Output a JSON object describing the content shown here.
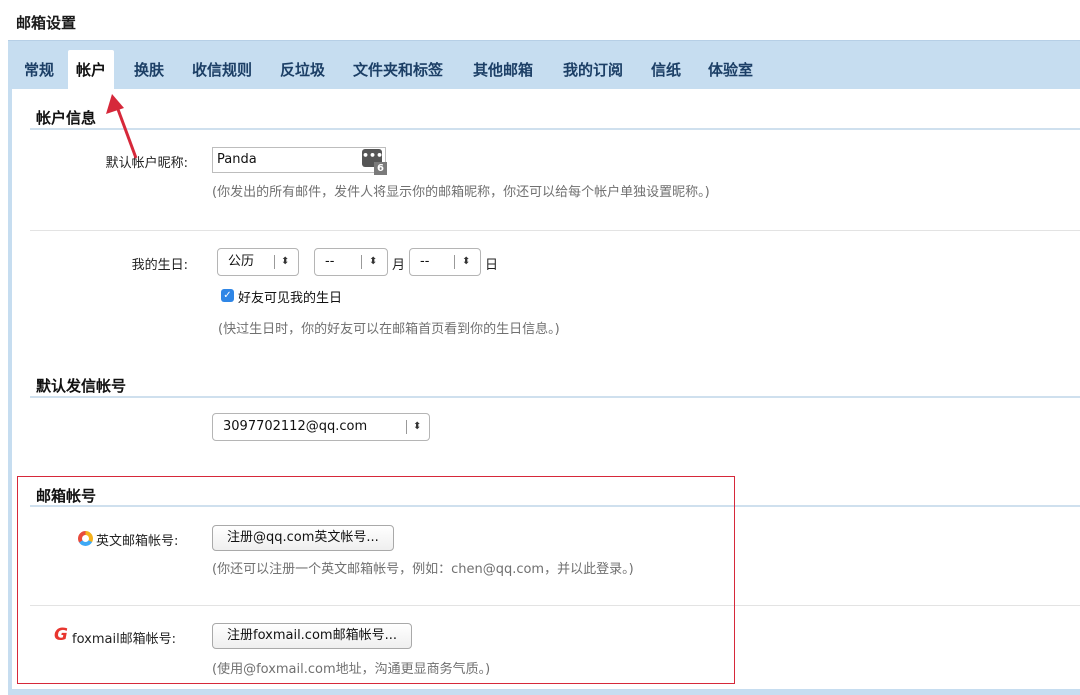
{
  "page": {
    "title": "邮箱设置"
  },
  "tabs": [
    {
      "label": "常规",
      "active": false
    },
    {
      "label": "帐户",
      "active": true
    },
    {
      "label": "换肤",
      "active": false
    },
    {
      "label": "收信规则",
      "active": false
    },
    {
      "label": "反垃圾",
      "active": false
    },
    {
      "label": "文件夹和标签",
      "active": false
    },
    {
      "label": "其他邮箱",
      "active": false
    },
    {
      "label": "我的订阅",
      "active": false
    },
    {
      "label": "信纸",
      "active": false
    },
    {
      "label": "体验室",
      "active": false
    }
  ],
  "account_info": {
    "title": "帐户信息",
    "nickname_label": "默认帐户昵称:",
    "nickname_value": "Panda",
    "emoji_glyph": "•••",
    "emoji_count": "6",
    "nickname_hint": "(你发出的所有邮件，发件人将显示你的邮箱昵称，你还可以给每个帐户单独设置昵称。)",
    "birthday_label": "我的生日:",
    "calendar_value": "公历",
    "month_value": "--",
    "month_unit": "月",
    "day_value": "--",
    "day_unit": "日",
    "friends_visible_label": "好友可见我的生日",
    "friends_visible_checked": true,
    "birthday_hint": "(快过生日时，你的好友可以在邮箱首页看到你的生日信息。)"
  },
  "default_sender": {
    "title": "默认发信帐号",
    "selected": "3097702112@qq.com"
  },
  "mail_accounts": {
    "title": "邮箱帐号",
    "english_label": "英文邮箱帐号:",
    "english_button": "注册@qq.com英文帐号...",
    "english_hint": "(你还可以注册一个英文邮箱帐号，例如：chen@qq.com，并以此登录。)",
    "foxmail_label": "foxmail邮箱帐号:",
    "foxmail_button": "注册foxmail.com邮箱帐号...",
    "foxmail_hint": "(使用@foxmail.com地址，沟通更显商务气质。)"
  },
  "select_arrow": "⬍",
  "colors": {
    "tab_bar": "#c6ddf0",
    "annotation_red": "#d6283a",
    "checkbox_blue": "#2f86e6"
  }
}
